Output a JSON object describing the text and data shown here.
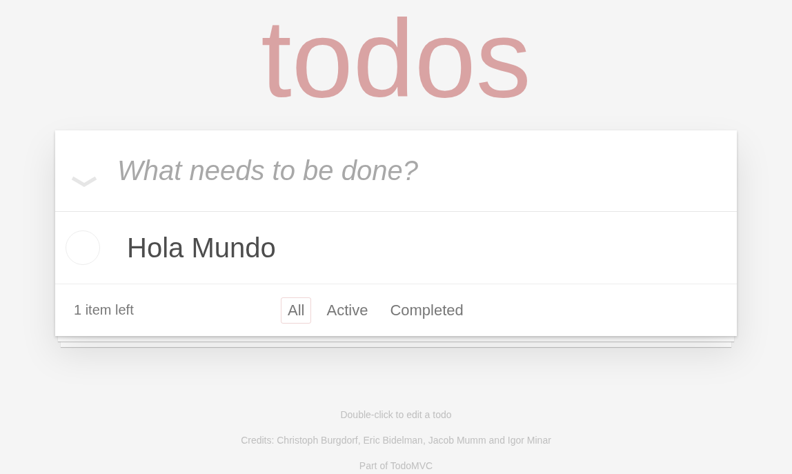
{
  "title": "todos",
  "new_todo": {
    "placeholder": "What needs to be done?"
  },
  "todos": [
    {
      "text": "Hola Mundo",
      "completed": false
    }
  ],
  "footer": {
    "count": "1 item left",
    "filters": [
      {
        "label": "All",
        "selected": true
      },
      {
        "label": "Active",
        "selected": false
      },
      {
        "label": "Completed",
        "selected": false
      }
    ]
  },
  "info": [
    "Double-click to edit a todo",
    "Credits: Christoph Burgdorf, Eric Bidelman, Jacob Mumm and Igor Minar",
    "Part of TodoMVC"
  ]
}
